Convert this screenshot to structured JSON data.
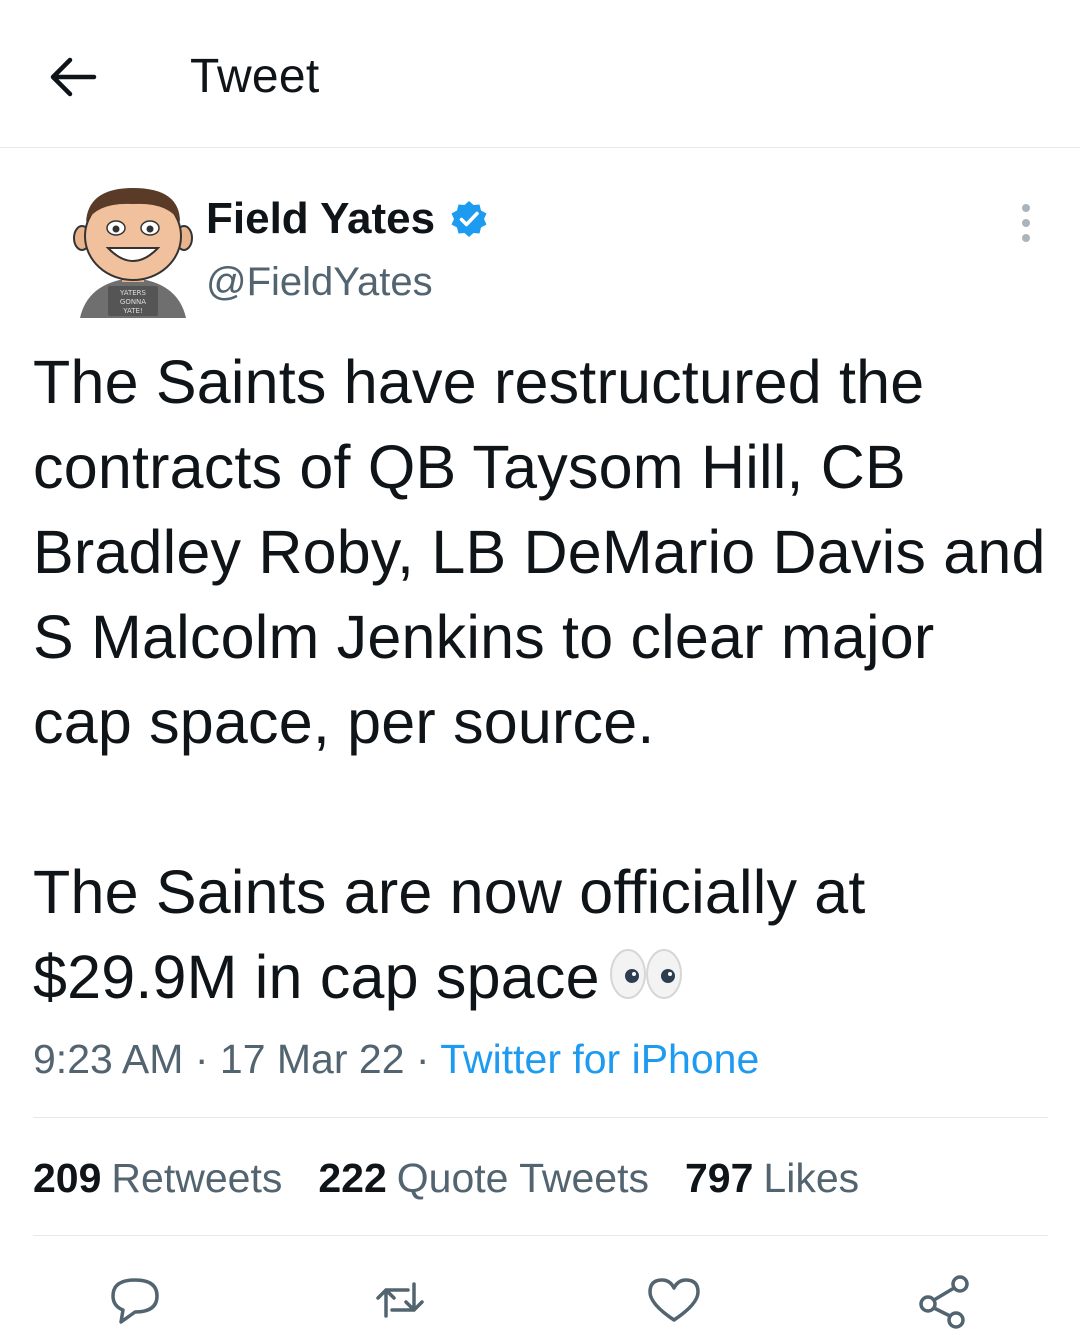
{
  "header": {
    "title": "Tweet",
    "back_icon": "arrow-left-icon"
  },
  "author": {
    "display_name": "Field Yates",
    "handle": "@FieldYates",
    "verified_color": "#1d9bf0",
    "avatar_shirt_text": [
      "YATERS",
      "GONNA",
      "YATE!"
    ]
  },
  "tweet": {
    "paragraphs": [
      "The Saints have restructured the contracts of QB Taysom Hill, CB Bradley Roby, LB DeMario Davis and S Malcolm Jenkins to clear major cap space, per source.",
      "The Saints are now officially at $29.9M in cap space"
    ],
    "emoji": "eyes-emoji"
  },
  "meta": {
    "time": "9:23 AM",
    "sep1": "·",
    "date": "17 Mar 22",
    "sep2": "·",
    "source": "Twitter for iPhone"
  },
  "stats": {
    "retweets_count": "209",
    "retweets_label": "Retweets",
    "quotes_count": "222",
    "quotes_label": "Quote Tweets",
    "likes_count": "797",
    "likes_label": "Likes"
  },
  "actions": [
    "reply-icon",
    "retweet-icon",
    "like-icon",
    "share-icon"
  ],
  "colors": {
    "text": "#0f1419",
    "secondary": "#536471",
    "accent": "#1d9bf0",
    "border": "#e6e9ec"
  }
}
